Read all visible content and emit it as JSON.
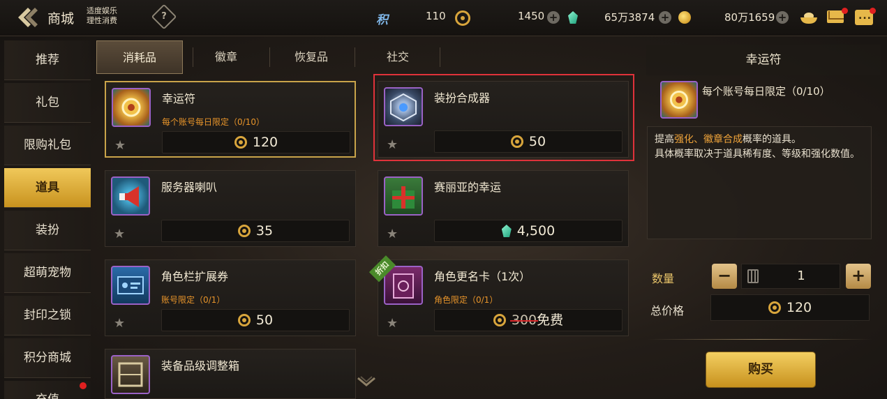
{
  "header": {
    "title": "商城",
    "moderate_line1": "适度娱乐",
    "moderate_line2": "理性消费",
    "help_icon": "?",
    "ji_label": "积",
    "points": "110",
    "coins": "1450",
    "gems": "65万3874",
    "gold": "80万1659",
    "plus": "+",
    "chat_dots": "..."
  },
  "sidebar": {
    "items": [
      {
        "label": "推荐"
      },
      {
        "label": "礼包"
      },
      {
        "label": "限购礼包"
      },
      {
        "label": "道具"
      },
      {
        "label": "装扮"
      },
      {
        "label": "超萌宠物"
      },
      {
        "label": "封印之锁"
      },
      {
        "label": "积分商城"
      },
      {
        "label": "充值"
      }
    ],
    "active_index": 3
  },
  "tabs": [
    {
      "label": "消耗品"
    },
    {
      "label": "徽章"
    },
    {
      "label": "恢复品"
    },
    {
      "label": "社交"
    }
  ],
  "items": [
    {
      "name": "幸运符",
      "limit": "每个账号每日限定（0/10）",
      "price": "120",
      "currency": "coin"
    },
    {
      "name": "装扮合成器",
      "limit": "",
      "price": "50",
      "currency": "coin"
    },
    {
      "name": "服务器喇叭",
      "limit": "",
      "price": "35",
      "currency": "coin"
    },
    {
      "name": "赛丽亚的幸运",
      "limit": "",
      "price": "4,500",
      "currency": "gem"
    },
    {
      "name": "角色栏扩展券",
      "limit": "账号限定（0/1）",
      "price": "50",
      "currency": "coin"
    },
    {
      "name": "角色更名卡（1次）",
      "limit": "角色限定（0/1）",
      "price_old": "300",
      "price_free": "免费",
      "currency": "coin",
      "tag": "折扣"
    },
    {
      "name": "装备品级调整箱",
      "limit": "",
      "price": "",
      "currency": "coin"
    }
  ],
  "detail": {
    "title": "幸运符",
    "limit": "每个账号每日限定（0/10）",
    "desc_prefix": "提高",
    "desc_hl1": "强化",
    "desc_sep": "、",
    "desc_hl2": "徽章合成",
    "desc_suffix": "概率的道具。",
    "desc_line2": "具体概率取决于道具稀有度、等级和强化数值。",
    "qty_label": "数量",
    "qty_minus": "−",
    "qty_plus": "+",
    "qty": "1",
    "total_label": "总价格",
    "total": "120",
    "buy_label": "购买"
  },
  "colors": {
    "accent": "#c9a44a",
    "highlight": "#e0323a",
    "limit": "#e7942a"
  }
}
